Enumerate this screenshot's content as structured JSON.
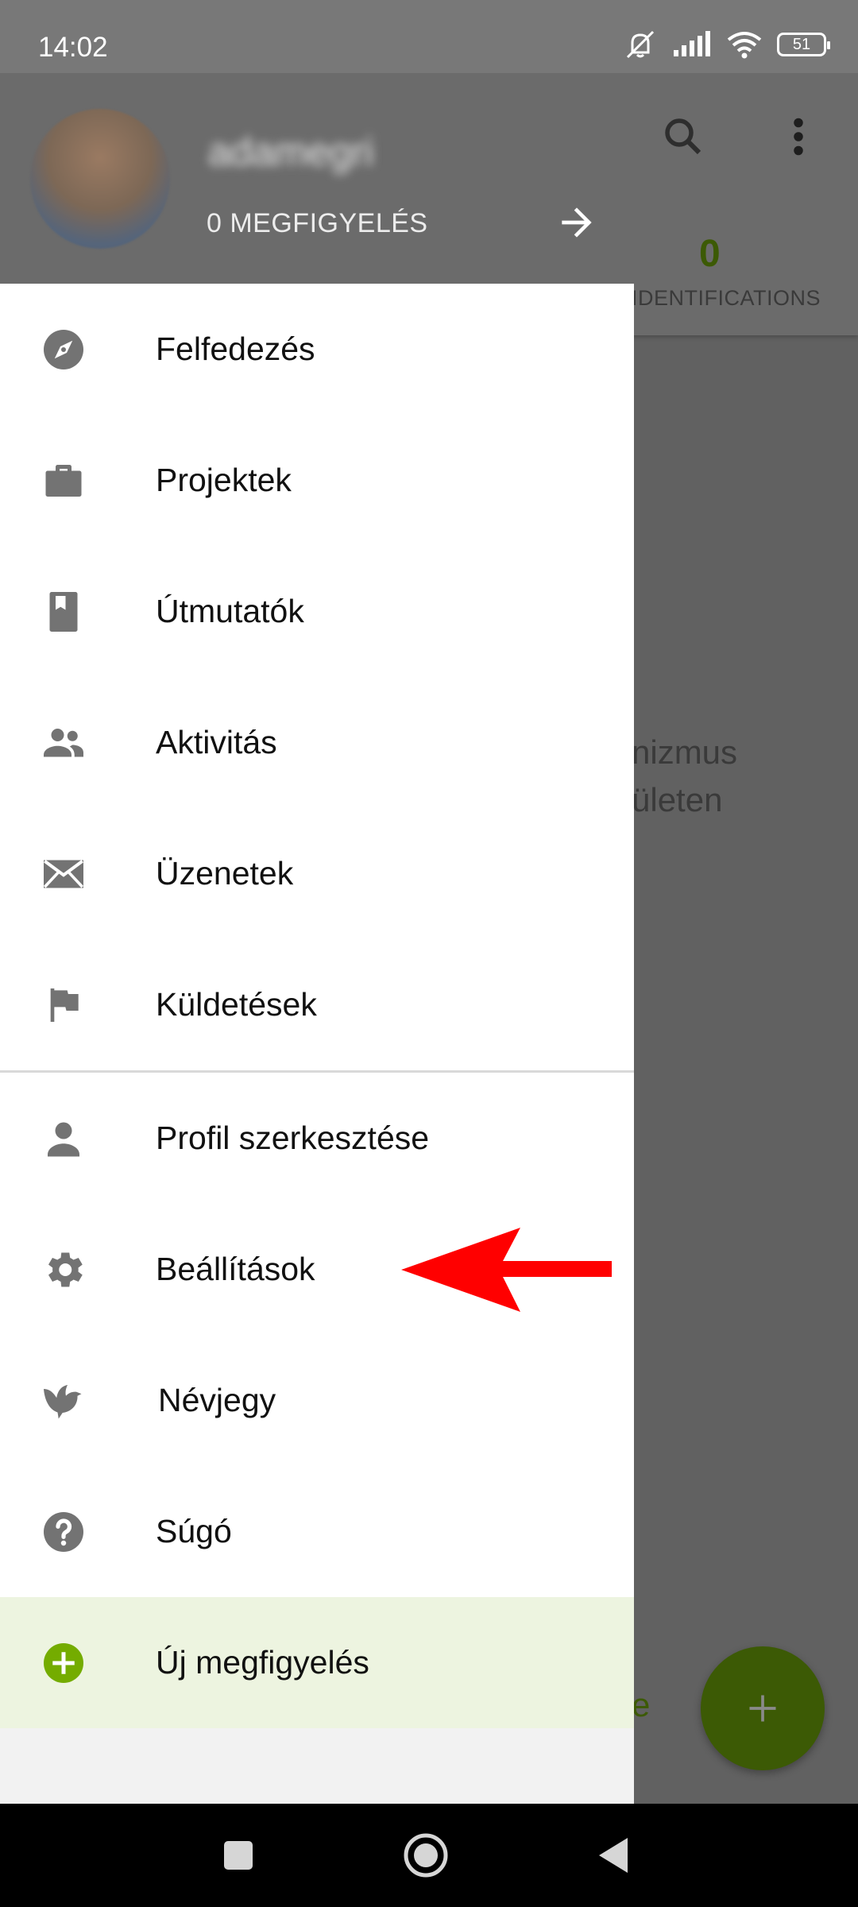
{
  "status_bar": {
    "time": "14:02",
    "battery": "51"
  },
  "background_app": {
    "identifications_count": "0",
    "identifications_label": "IDENTIFICATIONS",
    "empty_state_text": "nizmus\nületen",
    "bottom_link_fragment": "e"
  },
  "drawer": {
    "header": {
      "username": "adamegri",
      "observations_count": "0 MEGFIGYELÉS"
    },
    "primary_items": [
      {
        "label": "Felfedezés",
        "icon": "compass-icon"
      },
      {
        "label": "Projektek",
        "icon": "briefcase-icon"
      },
      {
        "label": "Útmutatók",
        "icon": "book-icon"
      },
      {
        "label": "Aktivitás",
        "icon": "people-icon"
      },
      {
        "label": "Üzenetek",
        "icon": "mail-icon"
      },
      {
        "label": "Küldetések",
        "icon": "flag-icon"
      }
    ],
    "secondary_items": [
      {
        "label": "Profil szerkesztése",
        "icon": "person-icon"
      },
      {
        "label": "Beállítások",
        "icon": "gear-icon"
      },
      {
        "label": "Névjegy",
        "icon": "bird-icon"
      },
      {
        "label": "Súgó",
        "icon": "help-icon"
      }
    ],
    "new_observation": {
      "label": "Új megfigyelés",
      "icon": "add-circle-icon",
      "color": "#74ac00"
    }
  },
  "colors": {
    "accent_dark": "#3c5a05",
    "annotation_arrow": "#ff0000"
  }
}
